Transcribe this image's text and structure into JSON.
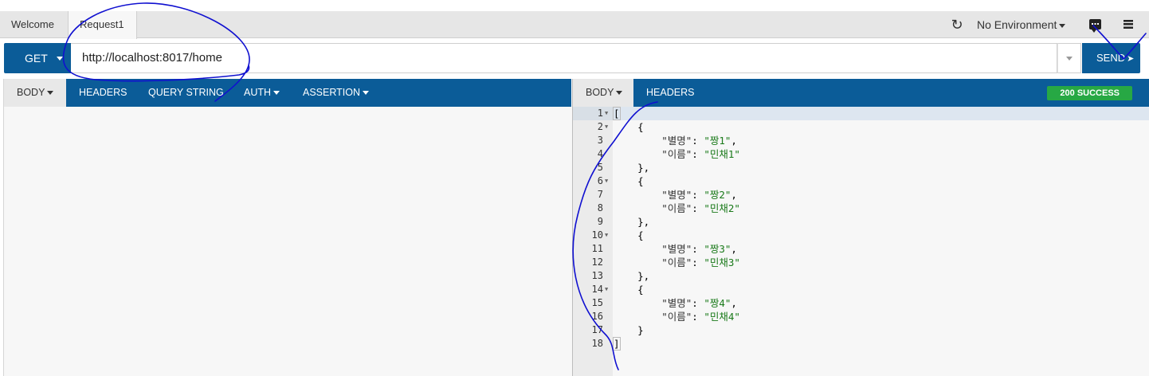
{
  "tabs": {
    "welcome": "Welcome",
    "request": "Request1"
  },
  "topbar": {
    "refresh_icon": "refresh-icon",
    "environment": "No Environment",
    "chat_icon": "chat-icon",
    "menu_icon": "hamburger-menu-icon"
  },
  "request": {
    "method": "GET",
    "url": "http://localhost:8017/home",
    "send_label": "SEND"
  },
  "request_tabs": {
    "body": "BODY",
    "headers": "HEADERS",
    "query_string": "QUERY STRING",
    "auth": "AUTH",
    "assertion": "ASSERTION"
  },
  "response_tabs": {
    "body": "BODY",
    "headers": "HEADERS"
  },
  "response": {
    "status": "200 SUCCESS",
    "line_numbers": [
      "1",
      "2",
      "3",
      "4",
      "5",
      "6",
      "7",
      "8",
      "9",
      "10",
      "11",
      "12",
      "13",
      "14",
      "15",
      "16",
      "17",
      "18"
    ],
    "items": [
      {
        "key1": "\"별명\"",
        "val1": "\"짱1\"",
        "key2": "\"이름\"",
        "val2": "\"민채1\""
      },
      {
        "key1": "\"별명\"",
        "val1": "\"짱2\"",
        "key2": "\"이름\"",
        "val2": "\"민채2\""
      },
      {
        "key1": "\"별명\"",
        "val1": "\"짱3\"",
        "key2": "\"이름\"",
        "val2": "\"민채3\""
      },
      {
        "key1": "\"별명\"",
        "val1": "\"짱4\"",
        "key2": "\"이름\"",
        "val2": "\"민채4\""
      }
    ]
  },
  "colors": {
    "primary": "#0b5c98",
    "success": "#27a844",
    "annotation": "#1010d0"
  }
}
